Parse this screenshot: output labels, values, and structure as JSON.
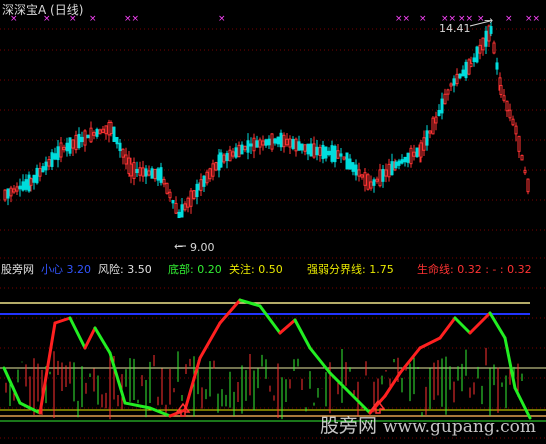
{
  "header": {
    "title": "深深宝A (日线)"
  },
  "price_chart": {
    "high_label": "14.41",
    "low_label": "9.00",
    "colors": {
      "up": "#ff3333",
      "down": "#00dddd",
      "signal": "#ff44ff",
      "grid": "#7a0000"
    }
  },
  "indicator_legend": {
    "name": "股旁网",
    "items": [
      {
        "key": "xiaoxin",
        "label": "小心",
        "value": "3.20",
        "color": "#3355ff"
      },
      {
        "key": "fengxian",
        "label": "风险",
        "value": "3.50",
        "color": "#e0e0e0"
      },
      {
        "key": "dibu",
        "label": "底部",
        "value": "0.20",
        "color": "#33ee33"
      },
      {
        "key": "guanzhu",
        "label": "关注",
        "value": "0.50",
        "color": "#e8e800"
      },
      {
        "key": "qiangruo",
        "label": "强弱分界线",
        "value": "1.75",
        "color": "#e8e800"
      },
      {
        "key": "shengming",
        "label": "生命线",
        "value": "0.32",
        "color": "#ff3333"
      }
    ],
    "extra": ": - : 0.32"
  },
  "watermark": {
    "brand": "股旁网",
    "url": "www.gupang.com"
  }
}
